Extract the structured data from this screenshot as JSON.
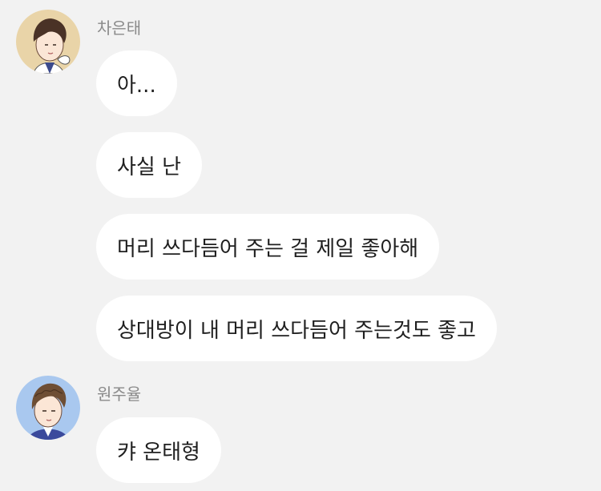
{
  "conversation": {
    "groups": [
      {
        "sender": "차은태",
        "avatar_icon": "boy-brown-hair-avatar-icon",
        "messages": [
          "아...",
          "사실 난",
          "머리 쓰다듬어 주는 걸 제일 좋아해",
          "상대방이 내 머리 쓰다듬어 주는것도 좋고"
        ]
      },
      {
        "sender": "원주율",
        "avatar_icon": "boy-wavy-hair-avatar-icon",
        "messages": [
          "캬 온태형"
        ]
      }
    ]
  },
  "colors": {
    "background": "#f2f2f2",
    "bubble": "#ffffff",
    "sender_name": "#8a8a8a",
    "message_text": "#1f1f1f",
    "avatar1_bg": "#e9d4a8",
    "avatar2_bg": "#a9c8ef"
  }
}
